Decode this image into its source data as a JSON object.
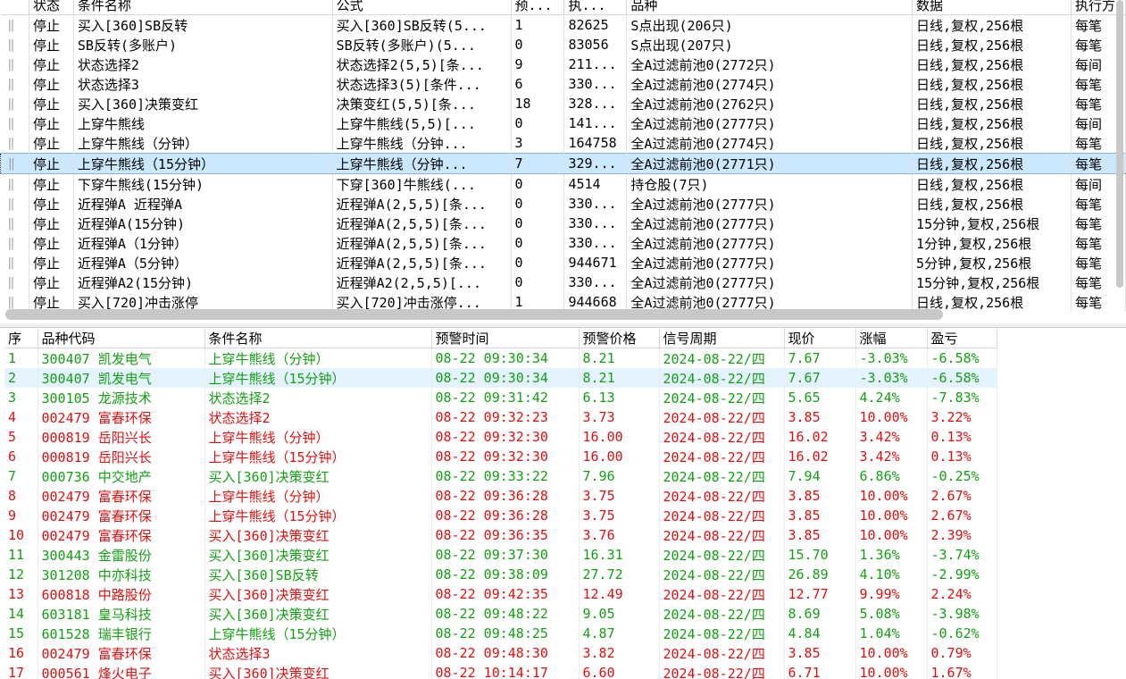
{
  "strategies": {
    "columns": [
      "",
      "状态",
      "条件名称",
      "公式",
      "预...",
      "执...",
      "品种",
      "数据",
      "执行方"
    ],
    "rows": [
      {
        "status": "停止",
        "name": "买入[360]SB反转",
        "formula": "买入[360]SB反转(5...",
        "warn": "1",
        "exec": "82625",
        "variety": "S点出现(206只)",
        "data": "日线,复权,256根",
        "mode": "每笔"
      },
      {
        "status": "停止",
        "name": "SB反转(多账户)",
        "formula": "SB反转(多账户)(5...",
        "warn": "0",
        "exec": "83056",
        "variety": "S点出现(207只)",
        "data": "日线,复权,256根",
        "mode": "每笔"
      },
      {
        "status": "停止",
        "name": "状态选择2",
        "formula": "状态选择2(5,5)[条...",
        "warn": "9",
        "exec": "211...",
        "variety": "全A过滤前池0(2772只)",
        "data": "日线,复权,256根",
        "mode": "每间"
      },
      {
        "status": "停止",
        "name": "状态选择3",
        "formula": "状态选择3(5)[条件...",
        "warn": "6",
        "exec": "330...",
        "variety": "全A过滤前池0(2774只)",
        "data": "日线,复权,256根",
        "mode": "每笔"
      },
      {
        "status": "停止",
        "name": "买入[360]决策变红",
        "formula": "决策变红(5,5)[条...",
        "warn": "18",
        "exec": "328...",
        "variety": "全A过滤前池0(2762只)",
        "data": "日线,复权,256根",
        "mode": "每笔"
      },
      {
        "status": "停止",
        "name": "上穿牛熊线",
        "formula": "上穿牛熊线(5,5)[...",
        "warn": "0",
        "exec": "141...",
        "variety": "全A过滤前池0(2777只)",
        "data": "日线,复权,256根",
        "mode": "每间"
      },
      {
        "status": "停止",
        "name": "上穿牛熊线（分钟）",
        "formula": "上穿牛熊线（分钟...",
        "warn": "3",
        "exec": "164758",
        "variety": "全A过滤前池0(2774只)",
        "data": "日线,复权,256根",
        "mode": "每笔"
      },
      {
        "status": "停止",
        "name": "上穿牛熊线（15分钟）",
        "formula": "上穿牛熊线（分钟...",
        "warn": "7",
        "exec": "329...",
        "variety": "全A过滤前池0(2771只)",
        "data": "日线,复权,256根",
        "mode": "每笔"
      },
      {
        "status": "停止",
        "name": "下穿牛熊线(15分钟)",
        "formula": "下穿[360]牛熊线(...",
        "warn": "0",
        "exec": "4514",
        "variety": "持仓股(7只)",
        "data": "日线,复权,256根",
        "mode": "每间"
      },
      {
        "status": "停止",
        "name": "近程弹A 近程弹A",
        "formula": "近程弹A(2,5,5)[条...",
        "warn": "0",
        "exec": "330...",
        "variety": "全A过滤前池0(2777只)",
        "data": "日线,复权,256根",
        "mode": "每笔"
      },
      {
        "status": "停止",
        "name": "近程弹A(15分钟)",
        "formula": "近程弹A(2,5,5)[条...",
        "warn": "0",
        "exec": "330...",
        "variety": "全A过滤前池0(2777只)",
        "data": "15分钟,复权,256根",
        "mode": "每笔"
      },
      {
        "status": "停止",
        "name": "近程弹A（1分钟）",
        "formula": "近程弹A(2,5,5)[条...",
        "warn": "0",
        "exec": "330...",
        "variety": "全A过滤前池0(2777只)",
        "data": "1分钟,复权,256根",
        "mode": "每笔"
      },
      {
        "status": "停止",
        "name": "近程弹A（5分钟）",
        "formula": "近程弹A(2,5,5)[条...",
        "warn": "0",
        "exec": "944671",
        "variety": "全A过滤前池0(2777只)",
        "data": "5分钟,复权,256根",
        "mode": "每笔"
      },
      {
        "status": "停止",
        "name": "近程弹A2(15分钟)",
        "formula": "近程弹A2(2,5,5)[...",
        "warn": "0",
        "exec": "330...",
        "variety": "全A过滤前池0(2777只)",
        "data": "15分钟,复权,256根",
        "mode": "每笔"
      },
      {
        "status": "停止",
        "name": "买入[720]冲击涨停",
        "formula": "买入[720]冲击涨停...",
        "warn": "1",
        "exec": "944668",
        "variety": "全A过滤前池0(2777只)",
        "data": "日线,复权,256根",
        "mode": "每笔"
      }
    ]
  },
  "alerts": {
    "columns": [
      "序",
      "品种代码",
      "条件名称",
      "预警时间",
      "预警价格",
      "信号周期",
      "现价",
      "涨幅",
      "盈亏"
    ],
    "rows": [
      {
        "no": "1",
        "code": "300407 凯发电气",
        "cond": "上穿牛熊线（分钟）",
        "time": "08-22 09:30:34",
        "price": "8.21",
        "period": "2024-08-22/四",
        "cur": "7.67",
        "chg": "-3.03%",
        "pl": "-6.58%",
        "color": "g"
      },
      {
        "no": "2",
        "code": "300407 凯发电气",
        "cond": "上穿牛熊线（15分钟）",
        "time": "08-22 09:30:34",
        "price": "8.21",
        "period": "2024-08-22/四",
        "cur": "7.67",
        "chg": "-3.03%",
        "pl": "-6.58%",
        "color": "g"
      },
      {
        "no": "3",
        "code": "300105 龙源技术",
        "cond": "状态选择2",
        "time": "08-22 09:31:42",
        "price": "6.13",
        "period": "2024-08-22/四",
        "cur": "5.65",
        "chg": "4.24%",
        "pl": "-7.83%",
        "color": "g"
      },
      {
        "no": "4",
        "code": "002479 富春环保",
        "cond": "状态选择2",
        "time": "08-22 09:32:23",
        "price": "3.73",
        "period": "2024-08-22/四",
        "cur": "3.85",
        "chg": "10.00%",
        "pl": "3.22%",
        "color": "r"
      },
      {
        "no": "5",
        "code": "000819 岳阳兴长",
        "cond": "上穿牛熊线（分钟）",
        "time": "08-22 09:32:30",
        "price": "16.00",
        "period": "2024-08-22/四",
        "cur": "16.02",
        "chg": "3.42%",
        "pl": "0.13%",
        "color": "r"
      },
      {
        "no": "6",
        "code": "000819 岳阳兴长",
        "cond": "上穿牛熊线（15分钟）",
        "time": "08-22 09:32:30",
        "price": "16.00",
        "period": "2024-08-22/四",
        "cur": "16.02",
        "chg": "3.42%",
        "pl": "0.13%",
        "color": "r"
      },
      {
        "no": "7",
        "code": "000736 中交地产",
        "cond": "买入[360]决策变红",
        "time": "08-22 09:33:22",
        "price": "7.96",
        "period": "2024-08-22/四",
        "cur": "7.94",
        "chg": "6.86%",
        "pl": "-0.25%",
        "color": "g"
      },
      {
        "no": "8",
        "code": "002479 富春环保",
        "cond": "上穿牛熊线（分钟）",
        "time": "08-22 09:36:28",
        "price": "3.75",
        "period": "2024-08-22/四",
        "cur": "3.85",
        "chg": "10.00%",
        "pl": "2.67%",
        "color": "r"
      },
      {
        "no": "9",
        "code": "002479 富春环保",
        "cond": "上穿牛熊线（15分钟）",
        "time": "08-22 09:36:28",
        "price": "3.75",
        "period": "2024-08-22/四",
        "cur": "3.85",
        "chg": "10.00%",
        "pl": "2.67%",
        "color": "r"
      },
      {
        "no": "10",
        "code": "002479 富春环保",
        "cond": "买入[360]决策变红",
        "time": "08-22 09:36:35",
        "price": "3.76",
        "period": "2024-08-22/四",
        "cur": "3.85",
        "chg": "10.00%",
        "pl": "2.39%",
        "color": "r"
      },
      {
        "no": "11",
        "code": "300443 金雷股份",
        "cond": "买入[360]决策变红",
        "time": "08-22 09:37:30",
        "price": "16.31",
        "period": "2024-08-22/四",
        "cur": "15.70",
        "chg": "1.36%",
        "pl": "-3.74%",
        "color": "g"
      },
      {
        "no": "12",
        "code": "301208 中亦科技",
        "cond": "买入[360]SB反转",
        "time": "08-22 09:38:09",
        "price": "27.72",
        "period": "2024-08-22/四",
        "cur": "26.89",
        "chg": "4.10%",
        "pl": "-2.99%",
        "color": "g"
      },
      {
        "no": "13",
        "code": "600818 中路股份",
        "cond": "买入[360]决策变红",
        "time": "08-22 09:42:35",
        "price": "12.49",
        "period": "2024-08-22/四",
        "cur": "12.77",
        "chg": "9.99%",
        "pl": "2.24%",
        "color": "r"
      },
      {
        "no": "14",
        "code": "603181 皇马科技",
        "cond": "买入[360]决策变红",
        "time": "08-22 09:48:22",
        "price": "9.05",
        "period": "2024-08-22/四",
        "cur": "8.69",
        "chg": "5.08%",
        "pl": "-3.98%",
        "color": "g"
      },
      {
        "no": "15",
        "code": "601528 瑞丰银行",
        "cond": "上穿牛熊线（15分钟）",
        "time": "08-22 09:48:25",
        "price": "4.87",
        "period": "2024-08-22/四",
        "cur": "4.84",
        "chg": "1.04%",
        "pl": "-0.62%",
        "color": "g"
      },
      {
        "no": "16",
        "code": "002479 富春环保",
        "cond": "状态选择3",
        "time": "08-22 09:48:30",
        "price": "3.82",
        "period": "2024-08-22/四",
        "cur": "3.85",
        "chg": "10.00%",
        "pl": "0.79%",
        "color": "r"
      },
      {
        "no": "17",
        "code": "000561 烽火电子",
        "cond": "买入[360]决策变红",
        "time": "08-22 10:14:17",
        "price": "6.60",
        "period": "2024-08-22/四",
        "cur": "6.71",
        "chg": "10.00%",
        "pl": "1.67%",
        "color": "r"
      }
    ]
  }
}
